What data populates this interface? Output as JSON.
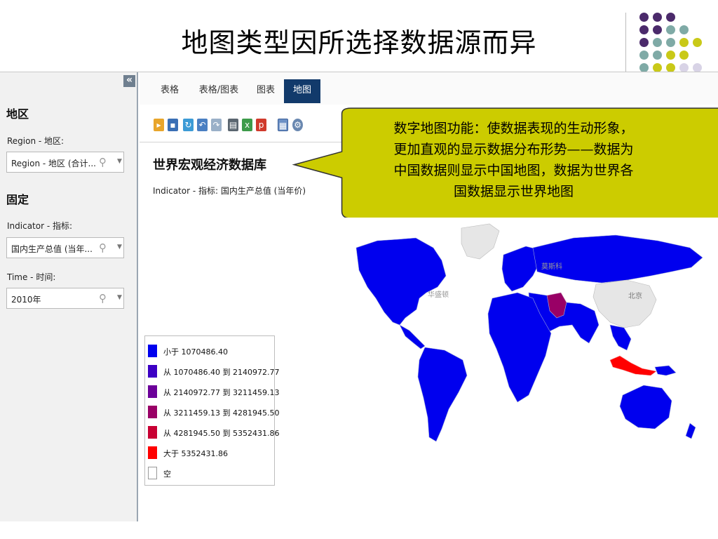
{
  "slide": {
    "title": "地图类型因所选择数据源而异",
    "dot_colors": [
      "#4b2a6b",
      "#7faaa6",
      "#c9c918",
      "#d8d3e6"
    ]
  },
  "sidebar": {
    "collapse_icon": "«",
    "section_region": "地区",
    "region_label": "Region - 地区:",
    "region_value": "Region - 地区 (合计...",
    "section_fixed": "固定",
    "indicator_label": "Indicator - 指标:",
    "indicator_value": "国内生产总值 (当年...",
    "time_label": "Time - 时间:",
    "time_value": "2010年",
    "search_icon": "search-icon",
    "dropdown_icon": "chevron-down-icon"
  },
  "tabs": [
    {
      "label": "表格",
      "active": false
    },
    {
      "label": "表格/图表",
      "active": false
    },
    {
      "label": "图表",
      "active": false
    },
    {
      "label": "地图",
      "active": true
    }
  ],
  "toolbar": {
    "icons": [
      "export-icon",
      "save-icon",
      "refresh-icon",
      "undo-icon",
      "redo-icon",
      "print-icon",
      "excel-icon",
      "pdf-icon",
      "layout-icon",
      "settings-icon"
    ]
  },
  "main": {
    "db_title": "世界宏观经济数据库",
    "indicator": "Indicator - 指标: 国内生产总值 (当年价)"
  },
  "legend": {
    "items": [
      {
        "label": "小于 1070486.40",
        "color": "#0000ee"
      },
      {
        "label": "从 1070486.40 到 2140972.77",
        "color": "#3c00c4"
      },
      {
        "label": "从 2140972.77 到 3211459.13",
        "color": "#6b0099"
      },
      {
        "label": "从 3211459.13 到 4281945.50",
        "color": "#990066"
      },
      {
        "label": "从 4281945.50 到 5352431.86",
        "color": "#c80033"
      },
      {
        "label": "大于 5352431.86",
        "color": "#ff0000"
      },
      {
        "label": "空",
        "color": "#ffffff"
      }
    ]
  },
  "map": {
    "labels": {
      "washington": "华盛顿",
      "moscow": "莫斯科",
      "beijing": "北京"
    },
    "colors": {
      "low": "#0000ee",
      "high": "#ff0000",
      "mid": "#990066",
      "empty": "#e6e6e6"
    }
  },
  "callout": {
    "lines": [
      "数字地图功能：使数据表现的生动形象，",
      "更加直观的显示数据分布形势——数据为",
      "中国数据则显示中国地图，数据为世界各",
      "国数据显示世界地图"
    ],
    "fill": "#cccc00"
  }
}
